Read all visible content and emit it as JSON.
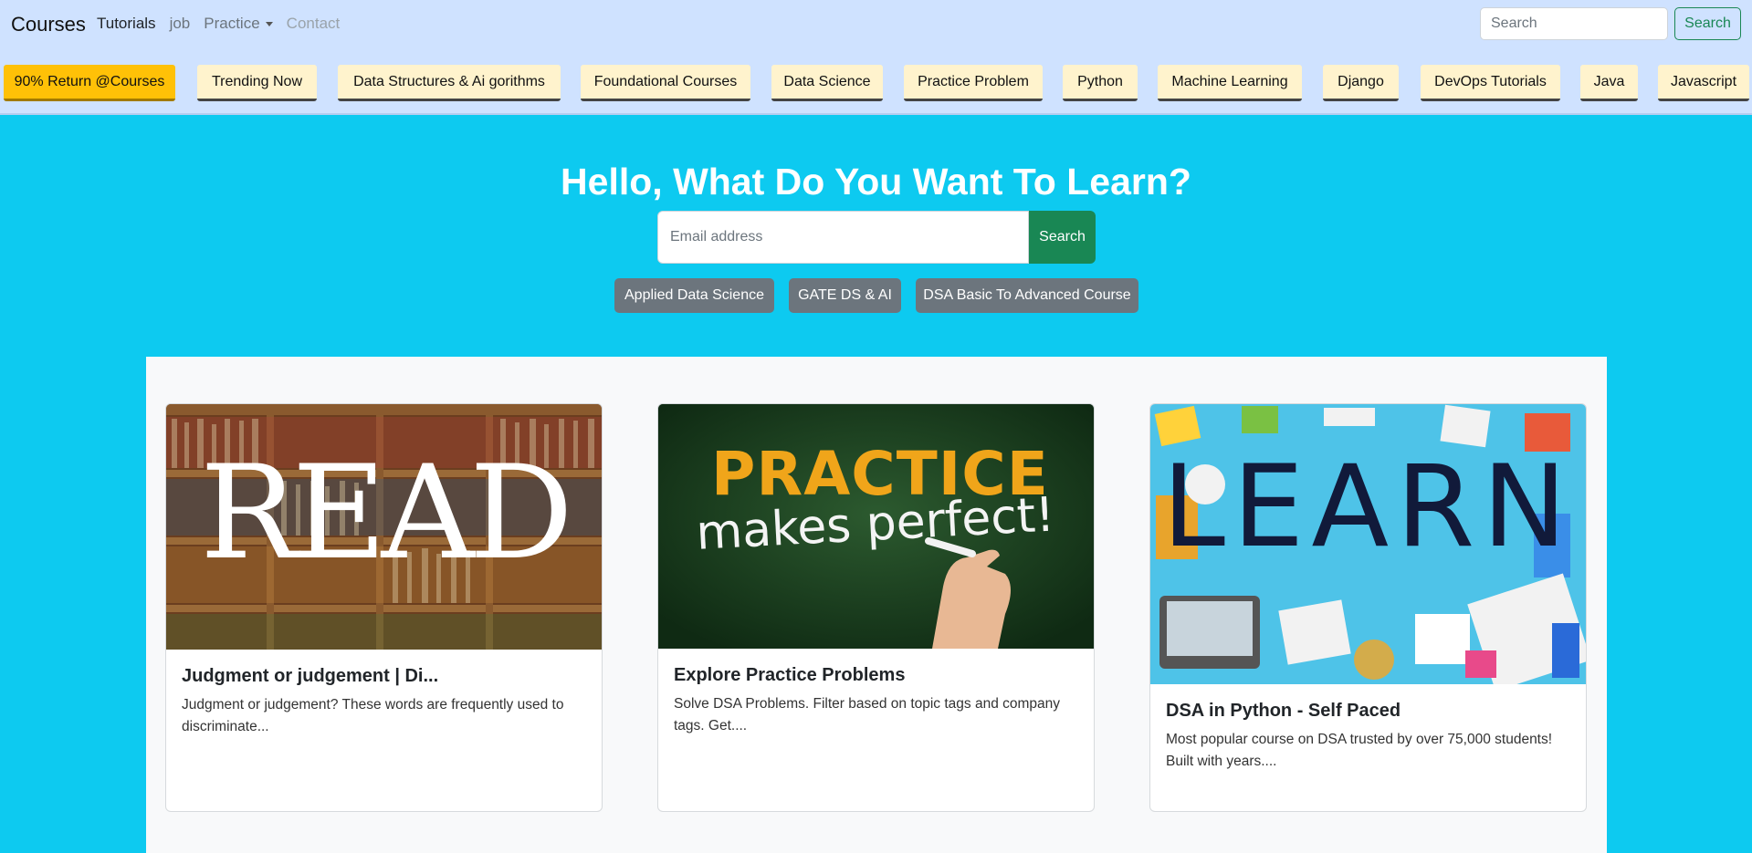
{
  "navbar": {
    "brand": "Courses",
    "links": [
      {
        "label": "Tutorials"
      },
      {
        "label": "job"
      },
      {
        "label": "Practice"
      },
      {
        "label": "Contact"
      }
    ],
    "search_placeholder": "Search",
    "search_button": "Search"
  },
  "categories": [
    "90% Return @Courses",
    "Trending Now",
    "Data Structures & Ai gorithms",
    "Foundational Courses",
    "Data Science",
    "Practice Problem",
    "Python",
    "Machine Learning",
    "Django",
    "DevOps Tutorials",
    "Java",
    "Javascript"
  ],
  "hero": {
    "title": "Hello, What Do You Want To Learn?",
    "input_placeholder": "Email address",
    "search_button": "Search",
    "tags": [
      "Applied Data Science",
      "GATE DS & AI",
      "DSA Basic To Advanced Course"
    ]
  },
  "cards": [
    {
      "image_word": "READ",
      "title": "Judgment or judgement | Di...",
      "text": "Judgment or judgement? These words are frequently used to discriminate..."
    },
    {
      "image_word_1": "PRACTICE",
      "image_word_2": "makes perfect!",
      "title": "Explore Practice Problems",
      "text": "Solve DSA Problems. Filter based on topic tags and company tags. Get...."
    },
    {
      "image_word": "LEARN",
      "title": "DSA in Python - Self Paced",
      "text": "Most popular course on DSA trusted by over 75,000 students! Built with years...."
    }
  ],
  "colors": {
    "navbar_bg": "#cfe2ff",
    "hero_bg": "#0dcaf0",
    "category_bg": "#fff3cd",
    "category_highlight": "#ffc107",
    "success": "#198754",
    "secondary": "#6c757d"
  }
}
